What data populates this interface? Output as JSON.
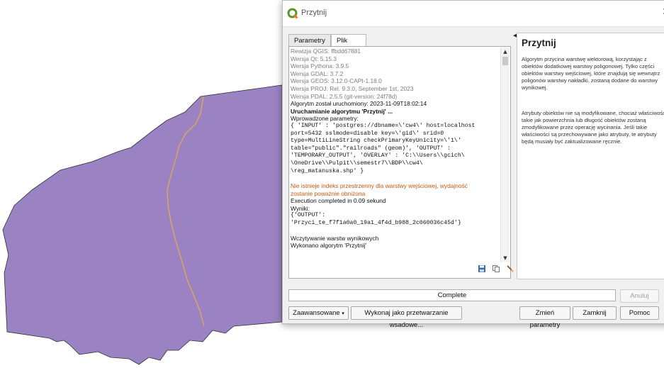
{
  "map": {
    "polygon_color": "#9b83c3",
    "railroad_color": "#e3a94d",
    "outline_color": "#2f2f2f"
  },
  "dialog": {
    "title": "Przytnij",
    "tabs": [
      "Parametry",
      "Plik zdarzeń"
    ],
    "log_lines": [
      {
        "text": "Rewizja QGIS: ffbdd67881",
        "style": "grey"
      },
      {
        "text": "Wersja Qt: 5.15.3",
        "style": "grey"
      },
      {
        "text": "Wersja Pythona: 3.9.5",
        "style": "grey"
      },
      {
        "text": "Wersja GDAL: 3.7.2",
        "style": "grey"
      },
      {
        "text": "Wersja GEOS: 3.12.0-CAPI-1.18.0",
        "style": "grey"
      },
      {
        "text": "Wersja PROJ: Rel. 9.3.0, September 1st, 2023",
        "style": "grey"
      },
      {
        "text": "Wersja PDAL: 2.5.5 (git-version: 24f78d)",
        "style": "grey"
      },
      {
        "text": "Algorytm został uruchomiony: 2023-11-09T18:02:14",
        "style": "normal"
      },
      {
        "text": "Uruchamianie algorytmu 'Przytnij' ...",
        "style": "bold"
      },
      {
        "text": "Wprowadzone parametry:",
        "style": "normal"
      },
      {
        "text": "{ 'INPUT' : 'postgres://dbname=\\'cw4\\' host=localhost",
        "style": "mono"
      },
      {
        "text": "port=5432 sslmode=disable key=\\'gid\\' srid=0",
        "style": "mono"
      },
      {
        "text": "type=MultiLineString checkPrimaryKeyUnicity=\\'1\\'",
        "style": "mono"
      },
      {
        "text": "table=\"public\".\"railroads\" (geom)', 'OUTPUT' :",
        "style": "mono"
      },
      {
        "text": "'TEMPORARY_OUTPUT', 'OVERLAY' : 'C:\\\\Users\\\\gcich\\",
        "style": "mono"
      },
      {
        "text": "\\OneDrive\\\\Pulpit\\\\semestr7\\\\BDP\\\\cw4\\",
        "style": "mono"
      },
      {
        "text": "\\reg_matanuska.shp' }",
        "style": "mono"
      },
      {
        "text": "",
        "style": "gap"
      },
      {
        "text": "Nie istnieje indeks przestrzenny dla warstwy wejściowej, wydajność",
        "style": "orange"
      },
      {
        "text": "zostanie poważnie obniżona",
        "style": "orange"
      },
      {
        "text": "Execution completed in 0.09 sekund",
        "style": "normal"
      },
      {
        "text": "Wyniki:",
        "style": "normal"
      },
      {
        "text": "{'OUTPUT':",
        "style": "mono"
      },
      {
        "text": "'Przyci_te_f7f1a0a0_19a1_4f4d_b988_2c060036c45d'}",
        "style": "mono"
      },
      {
        "text": "",
        "style": "gap"
      },
      {
        "text": "Wczytywanie warstw wynikowych",
        "style": "normal"
      },
      {
        "text": "Wykonano algorytm 'Przytnij'",
        "style": "normal"
      }
    ],
    "help": {
      "title": "Przytnij",
      "paragraph1": "Algorytm przycina warstwę wektorową, korzystając z obiektów dodatkowej warstwy poligonowej. Tylko części obiektów warstwy wejściowej, które znajdują się wewnątrz poligonów warstwy nakładki, zostaną dodane do warstwy wynikowej.",
      "paragraph2": "Atrybuty obiektów nie są modyfikowane, chociaż właściwości takie jak powierzchnia lub długość obiektów zostaną zmodyfikowane przez operację wycinania. Jeśli takie właściwości są przechowywane jako atrybuty, te atrybuty będą musiały być zaktualizowane ręcznie."
    },
    "progress_label": "Complete",
    "buttons": {
      "cancel": "Anuluj",
      "advanced": "Zaawansowane",
      "batch": "Wykonaj jako przetwarzanie wsadowe...",
      "change_params": "Zmień parametry",
      "close": "Zamknij",
      "help": "Pomoc"
    }
  }
}
